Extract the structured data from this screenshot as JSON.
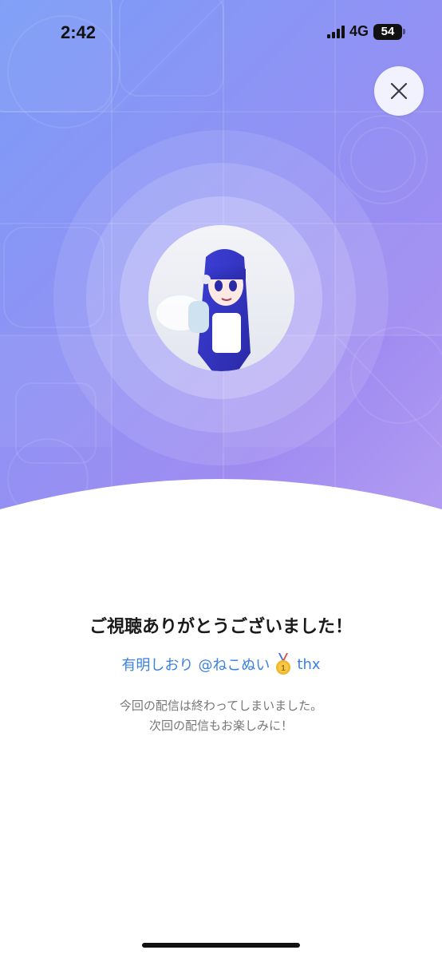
{
  "status_bar": {
    "time": "2:42",
    "network": "4G",
    "battery": "54"
  },
  "close_button": {
    "icon": "close-icon"
  },
  "streamer": {
    "avatar_icon": "streamer-avatar",
    "name": "有明しおり",
    "handle": "@ねこぬい",
    "badge_icon": "gold-medal-icon",
    "suffix": "thx"
  },
  "message": {
    "title": "ご視聴ありがとうございました！",
    "line1": "今回の配信は終わってしまいました。",
    "line2": "次回の配信もお楽しみに！"
  },
  "colors": {
    "gradient_start": "#7b9cf7",
    "gradient_end": "#b29cf2",
    "link_blue": "#3b82e0",
    "text_gray": "#777777"
  }
}
